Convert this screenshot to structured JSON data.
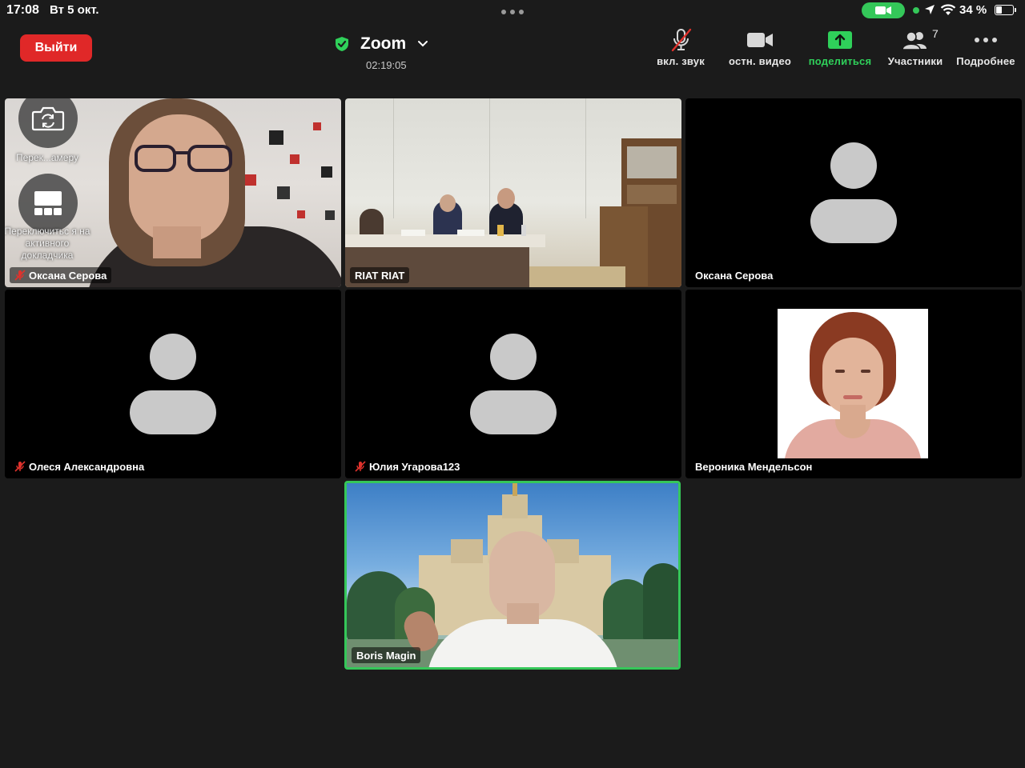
{
  "status_bar": {
    "time": "17:08",
    "date": "Вт 5 окт.",
    "battery_text": "34 %",
    "battery_level": 0.34,
    "icons": [
      "camera-in-use-icon",
      "location-arrow-icon",
      "wifi-icon",
      "battery-icon"
    ]
  },
  "meeting": {
    "leave_label": "Выйти",
    "title": "Zoom",
    "timer": "02:19:05",
    "encryption_icon": "shield-check-icon"
  },
  "toolbar": {
    "unmute_label": "вкл. звук",
    "stop_video_label": "остн. видео",
    "share_label": "поделиться",
    "participants_label": "Участники",
    "participants_count": "7",
    "more_label": "Подробнее"
  },
  "overlay": {
    "switch_camera_label": "Перек...амеру",
    "switch_speaker_label": "Переключитьс я на активного докладчика"
  },
  "tiles": [
    {
      "name": "Оксана Серова",
      "muted": true,
      "type": "camera"
    },
    {
      "name": "RIAT RIAT",
      "muted": false,
      "type": "camera"
    },
    {
      "name": "Оксана Серова",
      "muted": false,
      "type": "placeholder"
    },
    {
      "name": "Олеся Александровна",
      "muted": true,
      "type": "placeholder"
    },
    {
      "name": "Юлия Угарова123",
      "muted": true,
      "type": "placeholder"
    },
    {
      "name": "Вероника Мендельсон",
      "muted": false,
      "type": "photo"
    },
    {
      "name": "Boris Magin",
      "muted": false,
      "type": "camera",
      "active_speaker": true
    }
  ],
  "colors": {
    "background": "#1b1b1b",
    "leave": "#e02828",
    "accent_green": "#2fd05a",
    "active_border": "#35c759",
    "muted_red": "#e0322c",
    "placeholder_gray": "#c9c9c9"
  }
}
